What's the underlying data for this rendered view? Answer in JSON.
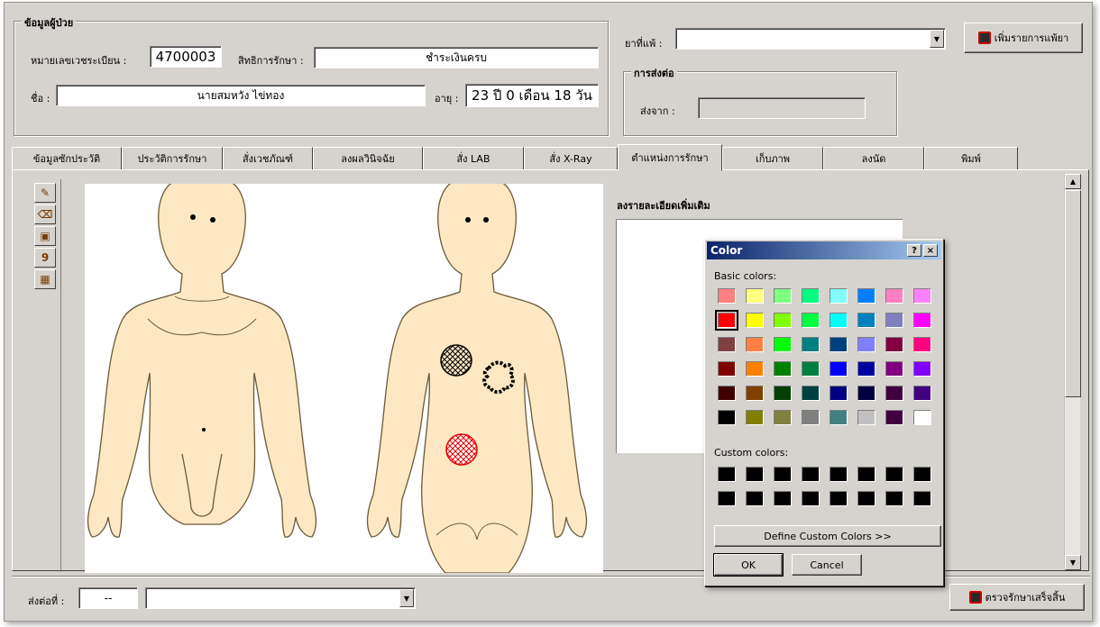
{
  "patient_group": {
    "title": "ข้อมูลผู้ป่วย",
    "hn_label": "หมายเลขเวชระเบียน :",
    "hn_value": "4700003",
    "right_label": "สิทธิการรักษา :",
    "right_value": "ชำระเงินครบ",
    "name_label": "ชื่อ :",
    "name_value": "นายสมหวัง ไข่ทอง",
    "age_label": "อายุ :",
    "age_value": "23 ปี 0 เดือน 18 วัน"
  },
  "allergy": {
    "label": "ยาที่แพ้ :",
    "value": ""
  },
  "add_drug_button": "เพิ่มรายการแพ้ยา",
  "referral_group": {
    "title": "การส่งต่อ",
    "from_label": "ส่งจาก :",
    "from_value": ""
  },
  "tabs": [
    {
      "label": "ข้อมูลซักประวัติ"
    },
    {
      "label": "ประวัติการรักษา"
    },
    {
      "label": "สั่งเวชภัณฑ์"
    },
    {
      "label": "ลงผลวินิจฉัย"
    },
    {
      "label": "สั่ง LAB"
    },
    {
      "label": "สั่ง X-Ray"
    },
    {
      "label": "ตำแหน่งการรักษา"
    },
    {
      "label": "เก็บภาพ"
    },
    {
      "label": "ลงนัด"
    },
    {
      "label": "พิมพ์"
    }
  ],
  "active_tab_index": 6,
  "toolbar_icons": [
    "pencil-icon",
    "eraser-icon",
    "fill-icon",
    "marker-icon",
    "palette-icon"
  ],
  "notes": {
    "label": "ลงรายละเอียดเพิ่มเติม",
    "value": ""
  },
  "bottom": {
    "refer_label": "ส่งต่อที่ :",
    "refer_code": "--",
    "refer_value": "",
    "finish_button": "ตรวจรักษาเสร็จสิ้น"
  },
  "color_dialog": {
    "title": "Color",
    "help_button": "?",
    "close_button": "×",
    "basic_label": "Basic colors:",
    "custom_label": "Custom colors:",
    "define_button": "Define Custom Colors >>",
    "ok_button": "OK",
    "cancel_button": "Cancel",
    "selected_color": "#ff0000",
    "basic_colors": [
      "#ff8080",
      "#ffff80",
      "#80ff80",
      "#00ff80",
      "#80ffff",
      "#0080ff",
      "#ff80c0",
      "#ff80ff",
      "#ff0000",
      "#ffff00",
      "#80ff00",
      "#00ff40",
      "#00ffff",
      "#0080c0",
      "#8080c0",
      "#ff00ff",
      "#804040",
      "#ff8040",
      "#00ff00",
      "#008080",
      "#004080",
      "#8080ff",
      "#800040",
      "#ff0080",
      "#800000",
      "#ff8000",
      "#008000",
      "#008040",
      "#0000ff",
      "#0000a0",
      "#800080",
      "#8000ff",
      "#400000",
      "#804000",
      "#004000",
      "#004040",
      "#000080",
      "#000040",
      "#400040",
      "#400080",
      "#000000",
      "#808000",
      "#808040",
      "#808080",
      "#408080",
      "#c0c0c0",
      "#400040",
      "#ffffff"
    ],
    "custom_colors": [
      "#000000",
      "#000000",
      "#000000",
      "#000000",
      "#000000",
      "#000000",
      "#000000",
      "#000000",
      "#000000",
      "#000000",
      "#000000",
      "#000000",
      "#000000",
      "#000000",
      "#000000",
      "#000000"
    ]
  }
}
